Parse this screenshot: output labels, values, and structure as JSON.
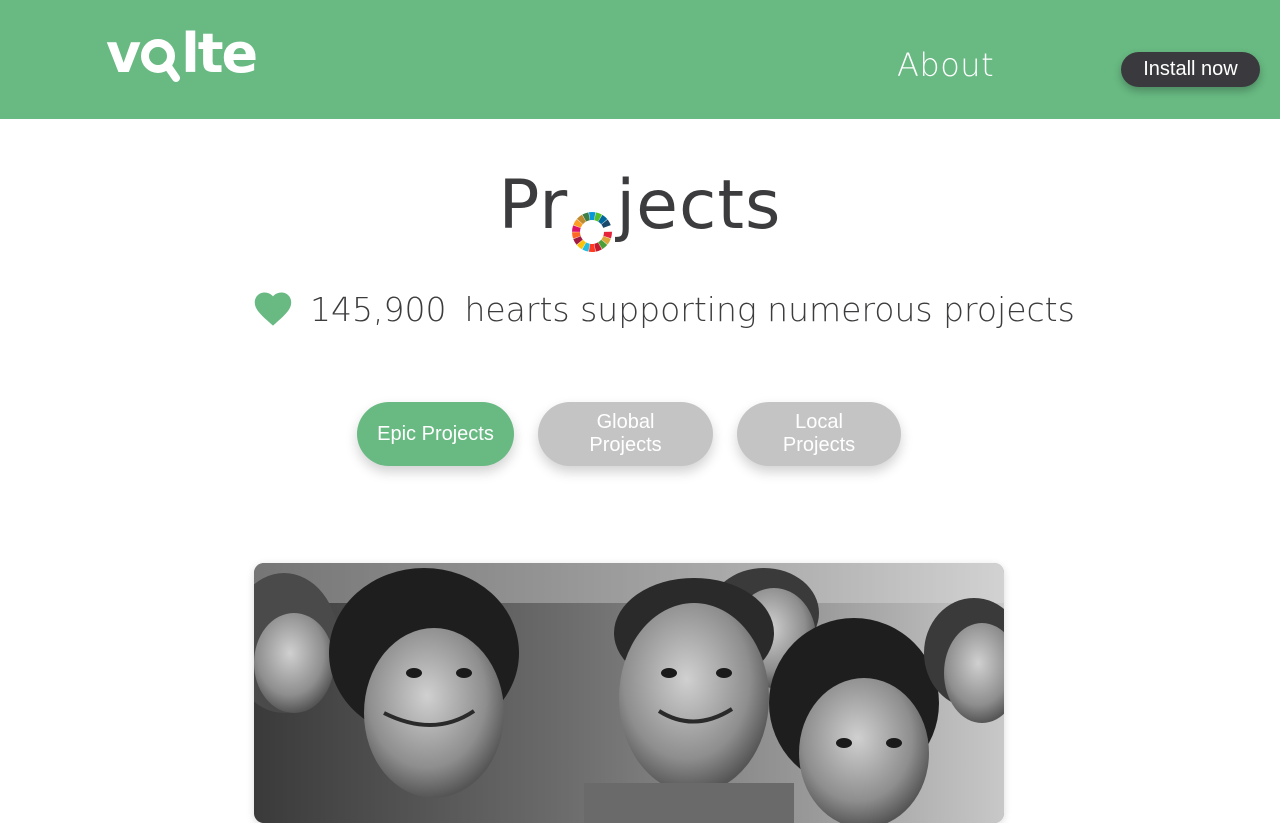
{
  "header": {
    "logo_text_left": "v",
    "logo_text_right": "lte",
    "nav_about": "About",
    "install_label": "Install now"
  },
  "main": {
    "title_left": "Pr",
    "title_right": "jects",
    "hearts_count": "145,900",
    "hearts_text": "hearts supporting numerous projects",
    "filters": [
      {
        "label": "Epic Projects",
        "active": true
      },
      {
        "label": "Global Projects",
        "active": false
      },
      {
        "label": "Local Projects",
        "active": false
      }
    ]
  },
  "colors": {
    "brand_green": "#68b982",
    "dark_button": "#3a3a3e",
    "inactive_filter": "#c4c4c4",
    "text_dark": "#3c3c3e"
  },
  "icons": {
    "logo_mark": "magnifier-a-icon",
    "title_o": "sdg-color-wheel-icon",
    "hearts": "heart-icon"
  }
}
